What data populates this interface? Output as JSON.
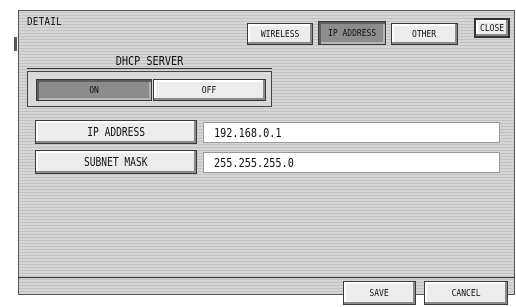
{
  "title": "DETAIL",
  "tabs": [
    {
      "label": "WIRELESS",
      "active": false
    },
    {
      "label": "IP ADDRESS",
      "active": true
    },
    {
      "label": "OTHER",
      "active": false
    }
  ],
  "close_label": "CLOSE",
  "dhcp": {
    "label": "DHCP SERVER",
    "on_label": "ON",
    "off_label": "OFF",
    "selected": "ON"
  },
  "fields": {
    "ip_address": {
      "label": "IP ADDRESS",
      "value": "192.168.0.1"
    },
    "subnet_mask": {
      "label": "SUBNET MASK",
      "value": "255.255.255.0"
    }
  },
  "footer": {
    "save_label": "SAVE",
    "cancel_label": "CANCEL"
  }
}
